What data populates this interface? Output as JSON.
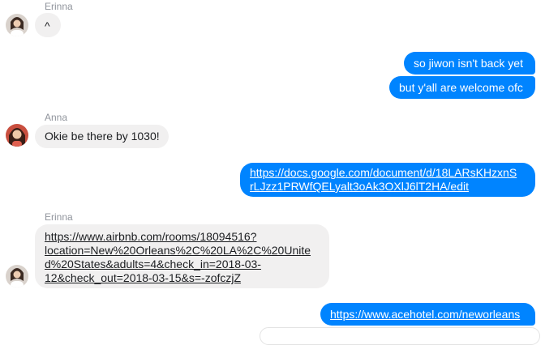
{
  "conversation": {
    "groups": [
      {
        "sender": "Erinna",
        "messages": [
          "^"
        ]
      },
      {
        "sender": "me",
        "messages": [
          "so jiwon isn't back yet",
          "but y'all are welcome ofc"
        ]
      },
      {
        "sender": "Anna",
        "messages": [
          "Okie be there by 1030!"
        ]
      },
      {
        "sender": "me",
        "messages": [
          "https://docs.google.com/document/d/18LARsKHzxnSrLJzz1PRWfQELyalt3oAk3OXlJ6lT2HA/edit"
        ]
      },
      {
        "sender": "Erinna",
        "messages": [
          "https://www.airbnb.com/rooms/18094516?location=New%20Orleans%2C%20LA%2C%20United%20States&adults=4&check_in=2018-03-12&check_out=2018-03-15&s=-zofczjZ"
        ]
      },
      {
        "sender": "me",
        "messages": [
          "https://www.acehotel.com/neworleans"
        ]
      }
    ]
  },
  "display": {
    "doc_link_line1": "https://docs.google.com/document/d/18LARsKHzxnS",
    "doc_link_line2": "rLJzz1PRWfQELyalt3oAk3OXlJ6lT2HA/edit",
    "airbnb_line1": "https://www.airbnb.com/rooms/18094516?",
    "airbnb_line2": "location=New%20Orleans%2C%20LA%2C%20Unite",
    "airbnb_line3": "d%20States&adults=4&check_in=2018-03-",
    "airbnb_line4": "12&check_out=2018-03-15&s=-zofczjZ"
  },
  "colors": {
    "outgoing_bubble": "#0084ff",
    "incoming_bubble": "#f1f0f0",
    "sender_name": "#90949c"
  }
}
